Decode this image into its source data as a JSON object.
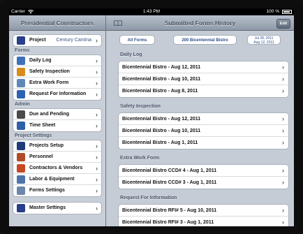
{
  "status_bar": {
    "carrier": "Carrier",
    "time": "1:43 PM",
    "battery": "100 %"
  },
  "left_pane": {
    "title": "Presidential Constructors",
    "project": {
      "label": "Project",
      "value": "Century Cantina"
    },
    "sections": [
      {
        "header": "Forms",
        "items": [
          {
            "label": "Daily Log",
            "icon": "calendar-icon",
            "color": "#3f6fb7"
          },
          {
            "label": "Safety Inspection",
            "icon": "hardhat-icon",
            "color": "#d98b1c"
          },
          {
            "label": "Extra Work Form",
            "icon": "document-icon",
            "color": "#5f87b8"
          },
          {
            "label": "Request For Information",
            "icon": "question-icon",
            "color": "#2d62b0"
          }
        ]
      },
      {
        "header": "Admin",
        "items": [
          {
            "label": "Due and Pending",
            "icon": "clock-icon",
            "color": "#4a4a4a"
          },
          {
            "label": "Time Sheet",
            "icon": "timesheet-icon",
            "color": "#2f5fa8"
          }
        ]
      },
      {
        "header": "Project Settings",
        "items": [
          {
            "label": "Projects Setup",
            "icon": "projects-icon",
            "color": "#1e3c7a"
          },
          {
            "label": "Personnel",
            "icon": "person-icon",
            "color": "#b24a2a"
          },
          {
            "label": "Contractors & Vendors",
            "icon": "contractors-icon",
            "color": "#c64826"
          },
          {
            "label": "Labor & Equipment",
            "icon": "equipment-icon",
            "color": "#4d73a8"
          },
          {
            "label": "Forms Settings",
            "icon": "forms-settings-icon",
            "color": "#6b86a8"
          }
        ]
      }
    ],
    "master": {
      "label": "Master Settings",
      "icon": "master-icon",
      "color": "#2a3f8a"
    }
  },
  "right_pane": {
    "title": "Submitted Forms History",
    "edit_label": "Edit",
    "filters": {
      "forms": "All Forms",
      "project": "200 Bicentennial Bistro",
      "date_from": "Jul 28, 2011",
      "date_to": "Aug 12, 2011"
    },
    "sections": [
      {
        "header": "Daily Log",
        "rows": [
          "Bicentennial Bistro - Aug 12, 2011",
          "Bicentennial Bistro - Aug 10, 2011",
          "Bicentennial Bistro - Aug 8, 2011"
        ]
      },
      {
        "header": "Safety Inspection",
        "rows": [
          "Bicentennial Bistro - Aug 12, 2011",
          "Bicentennial Bistro - Aug 10, 2011",
          "Bicentennial Bistro - Aug 1, 2011"
        ]
      },
      {
        "header": "Extra Work Form",
        "rows": [
          "Bicentennial Bistro CCD# 4 - Aug 1, 2011",
          "Bicentennial Bistro CCD# 3 - Aug 1, 2011"
        ]
      },
      {
        "header": "Request For Information",
        "rows": [
          "Bicentennial Bistro RFI# 5 - Aug 10, 2011",
          "Bicentennial Bistro RFI# 3 - Aug 1, 2011"
        ]
      }
    ]
  },
  "chevron": "›"
}
